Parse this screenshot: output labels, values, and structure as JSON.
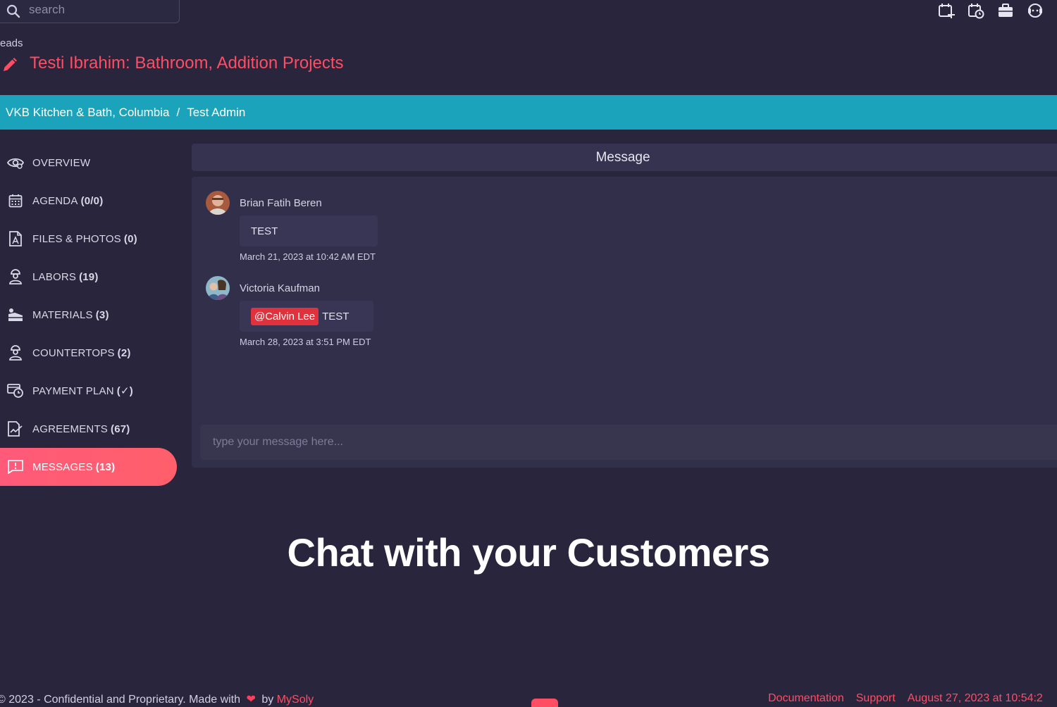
{
  "search": {
    "placeholder": "search"
  },
  "top_icons": [
    "calendar-add-icon",
    "calendar-clock-icon",
    "briefcase-icon",
    "support-icon"
  ],
  "header": {
    "breadcrumb_partial": "eads",
    "title": "Testi Ibrahim: Bathroom, Addition Projects"
  },
  "breadbar": {
    "company": "VKB Kitchen & Bath, Columbia",
    "separator": "/",
    "user": "Test Admin"
  },
  "sidebar": {
    "items": [
      {
        "label": "OVERVIEW",
        "count": "",
        "icon": "eye-icon"
      },
      {
        "label": "AGENDA",
        "count": "(0/0)",
        "icon": "calendar-icon"
      },
      {
        "label": "FILES & PHOTOS",
        "count": "(0)",
        "icon": "file-icon"
      },
      {
        "label": "LABORS",
        "count": "(19)",
        "icon": "worker-icon"
      },
      {
        "label": "MATERIALS",
        "count": "(3)",
        "icon": "materials-icon"
      },
      {
        "label": "COUNTERTOPS",
        "count": "(2)",
        "icon": "worker-icon"
      },
      {
        "label": "PAYMENT PLAN",
        "count": "(✓)",
        "icon": "payment-clock-icon"
      },
      {
        "label": "AGREEMENTS",
        "count": "(67)",
        "icon": "agreement-icon"
      },
      {
        "label": "MESSAGES",
        "count": "(13)",
        "icon": "message-icon",
        "active": true
      }
    ]
  },
  "messages": {
    "header": "Message",
    "list": [
      {
        "author": "Brian Fatih Beren",
        "mention": "",
        "text": "TEST",
        "timestamp": "March 21, 2023 at 10:42 AM EDT"
      },
      {
        "author": "Victoria Kaufman",
        "mention": "@Calvin Lee",
        "text": "TEST",
        "timestamp": "March 28, 2023 at 3:51 PM EDT"
      }
    ],
    "composer_placeholder": "type your message here..."
  },
  "overlay": {
    "text": "Chat with your Customers"
  },
  "footer": {
    "left_text": "2023 - Confidential and Proprietary. Made with",
    "by": "by",
    "brand": "MySoly",
    "links": [
      "Documentation",
      "Support"
    ],
    "timestamp": "August 27, 2023 at 10:54:2"
  },
  "colors": {
    "accent": "#ff4d63",
    "bar": "#1aa3bb",
    "background": "#28253d",
    "mention": "#e0323d"
  }
}
